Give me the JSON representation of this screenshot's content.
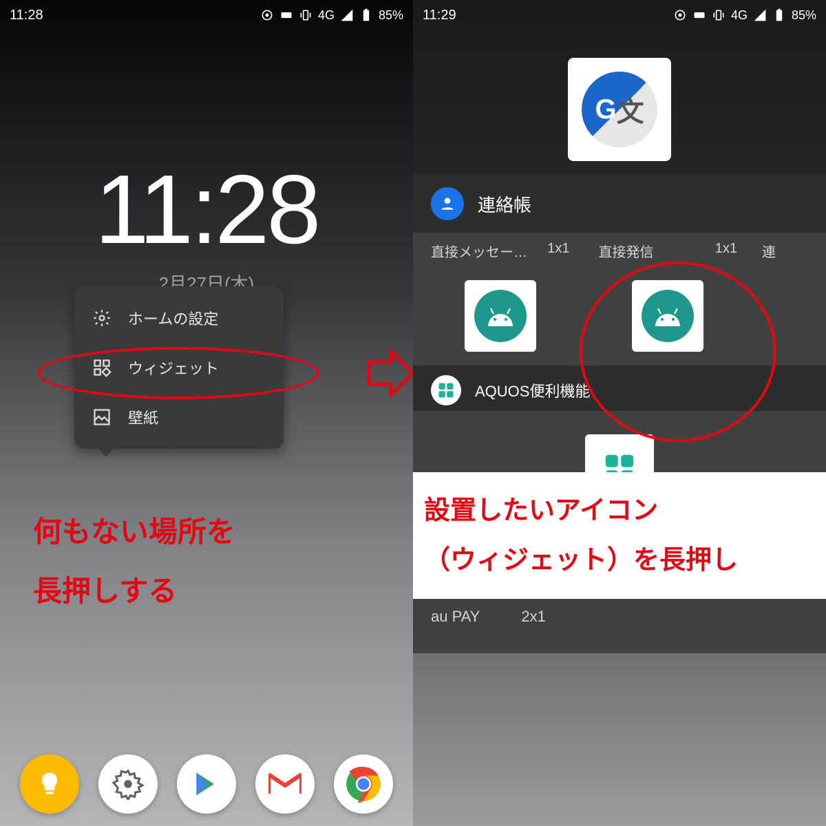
{
  "left": {
    "status_time": "11:28",
    "network": "4G",
    "battery": "85%",
    "clock": "11:28",
    "date_truncated": "2月27日(木)",
    "menu": {
      "home_settings": "ホームの設定",
      "widgets": "ウィジェット",
      "wallpaper": "壁紙"
    },
    "annotation_line1": "何もない場所を",
    "annotation_line2": "長押しする"
  },
  "right": {
    "status_time": "11:29",
    "network": "4G",
    "battery": "85%",
    "categories": {
      "contacts": {
        "label": "連絡帳"
      },
      "aquos": {
        "label": "AQUOS便利機能"
      },
      "aupay": {
        "label": "au PAY"
      }
    },
    "widgets": {
      "direct_message": {
        "label": "直接メッセー…",
        "size": "1x1"
      },
      "direct_call": {
        "label": "直接発信",
        "size": "1x1"
      },
      "contacts_short": {
        "label": "連"
      },
      "aupay_item": {
        "label": "au PAY",
        "size": "2x1"
      }
    },
    "annotation_line1": "設置したいアイコン",
    "annotation_line2": "（ウィジェット）を長押し"
  }
}
